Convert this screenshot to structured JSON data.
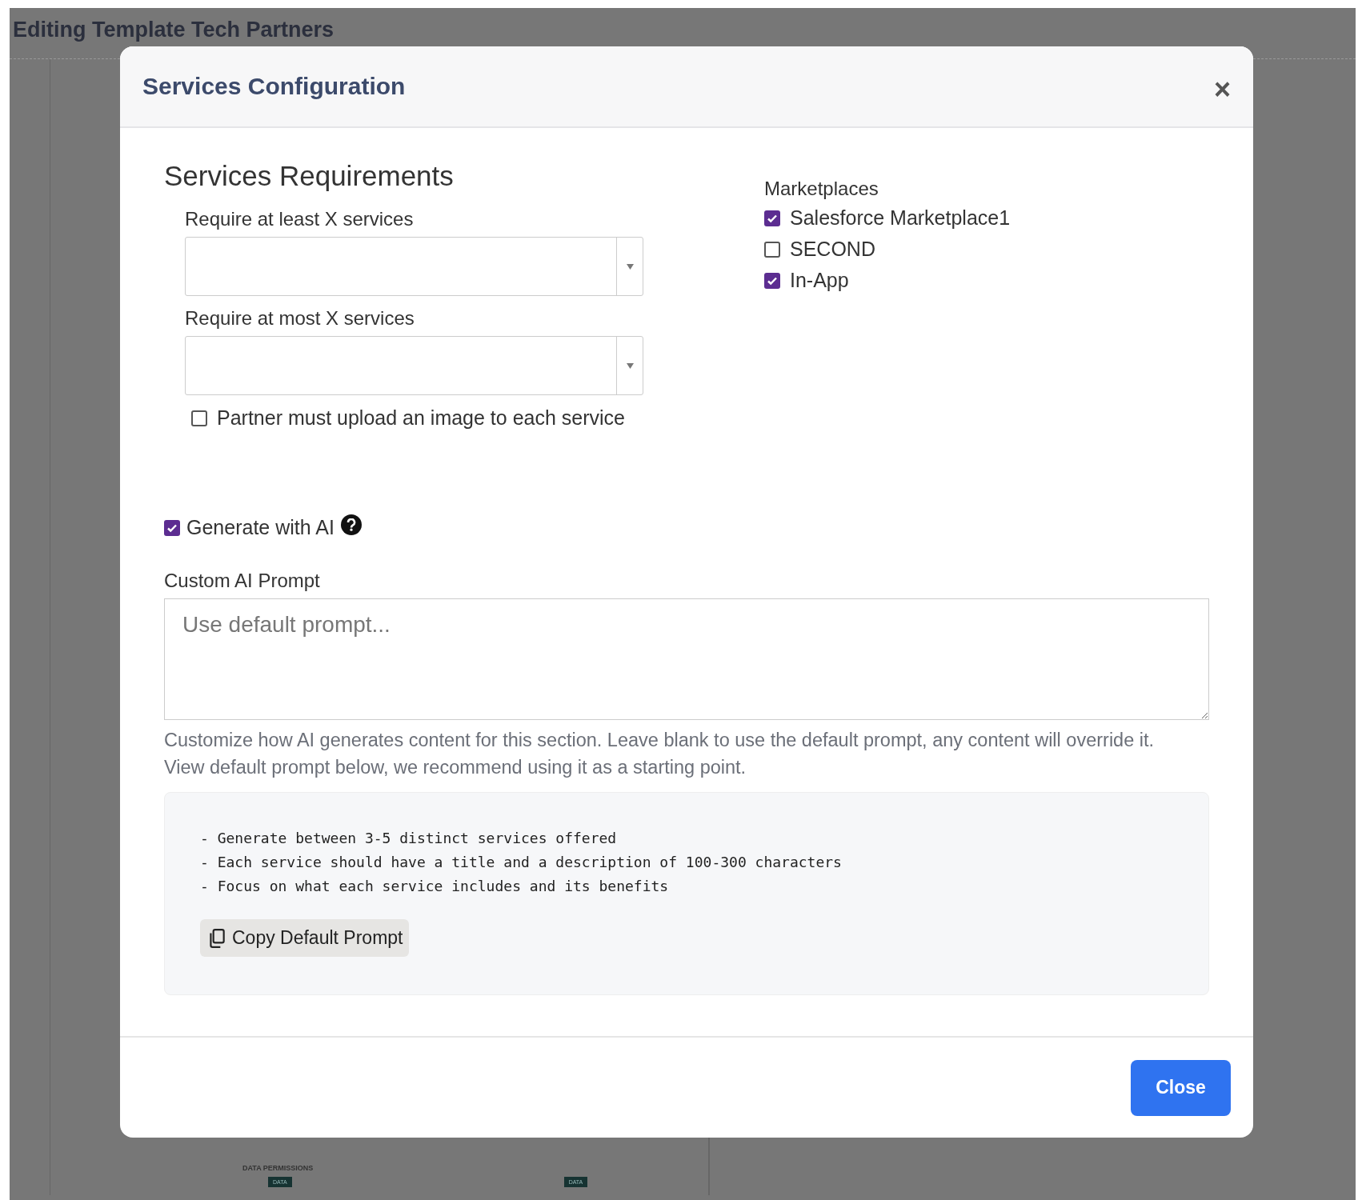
{
  "page": {
    "title": "Editing Template Tech Partners",
    "section_label": "DATA PERMISSIONS",
    "badges": [
      "DATA",
      "DATA"
    ]
  },
  "dialog": {
    "title": "Services Configuration",
    "close_icon": "×",
    "requirements": {
      "heading": "Services Requirements",
      "selects": [
        {
          "label": "Require at least X services"
        },
        {
          "label": "Require at most X services"
        }
      ],
      "image_upload": {
        "label": "Partner must upload an image to each service",
        "checked": false
      }
    },
    "marketplaces": {
      "label": "Marketplaces",
      "items": [
        {
          "label": "Salesforce Marketplace1",
          "checked": true
        },
        {
          "label": "SECOND",
          "checked": false
        },
        {
          "label": "In-App",
          "checked": true
        }
      ]
    },
    "ai": {
      "label": "Generate with AI",
      "checked": true,
      "prompt_label": "Custom AI Prompt",
      "prompt_placeholder": "Use default prompt...",
      "help_lines": [
        "Customize how AI generates content for this section. Leave blank to use the default prompt, any content will override it.",
        "View default prompt below, we recommend using it as a starting point."
      ],
      "default_prompt": [
        "- Generate between 3-5 distinct services offered",
        "- Each service should have a title and a description of 100-300 characters",
        "- Focus on what each service includes and its benefits"
      ],
      "copy_button": "Copy Default Prompt"
    },
    "footer_button": "Close"
  }
}
